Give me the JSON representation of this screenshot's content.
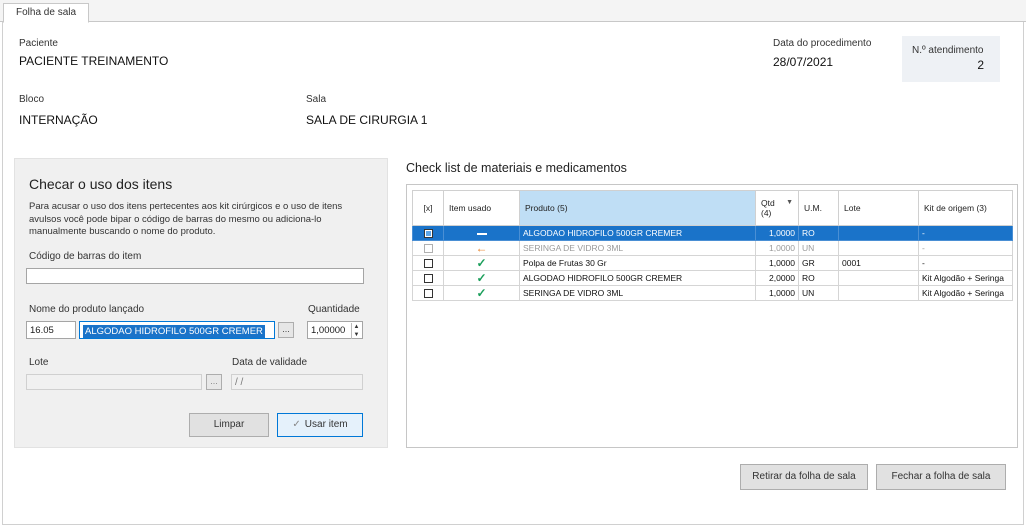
{
  "tab": {
    "label": "Folha de sala"
  },
  "header": {
    "paciente_label": "Paciente",
    "paciente_value": "PACIENTE TREINAMENTO",
    "data_label": "Data do procedimento",
    "data_value": "28/07/2021",
    "atendimento_label": "N.º atendimento",
    "atendimento_value": "2",
    "bloco_label": "Bloco",
    "bloco_value": "INTERNAÇÃO",
    "sala_label": "Sala",
    "sala_value": "SALA DE CIRURGIA 1"
  },
  "checar": {
    "title": "Checar o uso dos itens",
    "description": "Para acusar o uso dos itens pertecentes aos kit cirúrgicos e o uso de itens avulsos você pode bipar o código de barras do mesmo ou adiciona-lo manualmente buscando o nome do produto.",
    "barcode_label": "Código de barras do item",
    "barcode_value": "",
    "produto_label": "Nome do produto lançado",
    "produto_code": "16.05",
    "produto_name": "ALGODAO HIDROFILO 500GR CREMER",
    "browse_label": "...",
    "quantidade_label": "Quantidade",
    "quantidade_value": "1,00000",
    "lote_label": "Lote",
    "lote_browse": "...",
    "validade_label": "Data de validade",
    "validade_value": " / /",
    "limpar_label": "Limpar",
    "usar_label": "Usar item"
  },
  "checklist": {
    "title": "Check list de materiais e medicamentos",
    "columns": {
      "x": "[x]",
      "item_usado": "Item usado",
      "produto": "Produto (5)",
      "qtd": "Qtd (4)",
      "um": "U.M.",
      "lote": "Lote",
      "kit": "Kit de origem (3)"
    },
    "rows": [
      {
        "status": "dash",
        "produto": "ALGODAO HIDROFILO 500GR CREMER",
        "qtd": "1,0000",
        "um": "RO",
        "lote": "",
        "kit": "-"
      },
      {
        "status": "arrow",
        "produto": "SERINGA DE VIDRO 3ML",
        "qtd": "1,0000",
        "um": "UN",
        "lote": "",
        "kit": "-"
      },
      {
        "status": "check",
        "produto": "Polpa de Frutas 30 Gr",
        "qtd": "1,0000",
        "um": "GR",
        "lote": "0001",
        "kit": "-"
      },
      {
        "status": "check",
        "produto": "ALGODAO HIDROFILO 500GR CREMER",
        "qtd": "2,0000",
        "um": "RO",
        "lote": "",
        "kit": "Kit Algodão + Seringa"
      },
      {
        "status": "check",
        "produto": "SERINGA DE VIDRO 3ML",
        "qtd": "1,0000",
        "um": "UN",
        "lote": "",
        "kit": "Kit Algodão + Seringa"
      }
    ]
  },
  "footer": {
    "retirar_label": "Retirar da folha de sala",
    "fechar_label": "Fechar a folha de sala"
  }
}
